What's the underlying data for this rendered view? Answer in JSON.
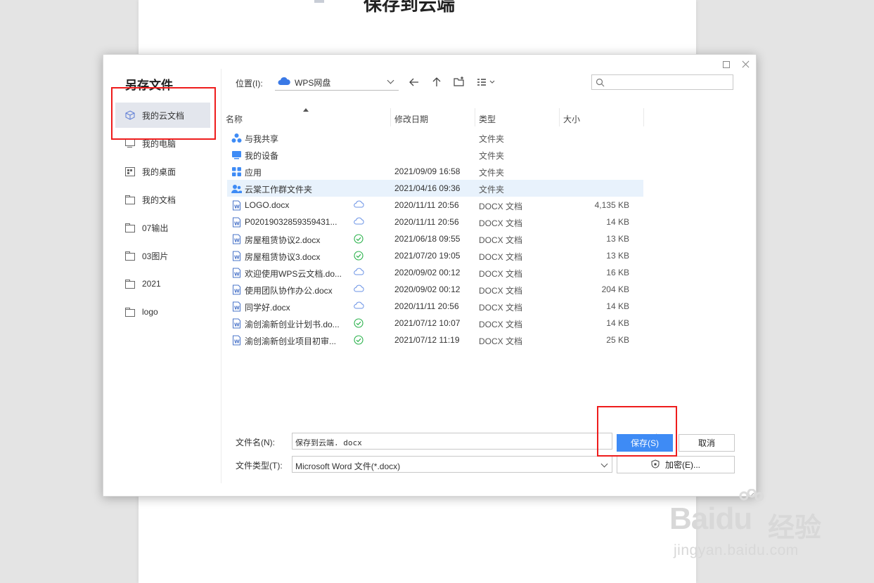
{
  "document": {
    "title_text": "保存到云端"
  },
  "dialog": {
    "title": "另存文件",
    "sidebar": [
      {
        "label": "我的云文档",
        "icon": "cloud-doc-icon",
        "active": true
      },
      {
        "label": "我的电脑",
        "icon": "computer-icon"
      },
      {
        "label": "我的桌面",
        "icon": "desktop-icon"
      },
      {
        "label": "我的文档",
        "icon": "folder-icon"
      },
      {
        "label": "07输出",
        "icon": "folder-icon"
      },
      {
        "label": "03图片",
        "icon": "folder-icon"
      },
      {
        "label": "2021",
        "icon": "folder-icon"
      },
      {
        "label": "logo",
        "icon": "folder-icon"
      }
    ],
    "toolbar": {
      "location_label": "位置(I):",
      "location_value": "WPS网盘",
      "search_placeholder": ""
    },
    "columns": {
      "name": "名称",
      "modified": "修改日期",
      "type": "类型",
      "size": "大小"
    },
    "files": [
      {
        "name": "与我共享",
        "icon": "share-folder-icon",
        "sync": "",
        "date": "",
        "type": "文件夹",
        "size": ""
      },
      {
        "name": "我的设备",
        "icon": "device-folder-icon",
        "sync": "",
        "date": "",
        "type": "文件夹",
        "size": ""
      },
      {
        "name": "应用",
        "icon": "apps-folder-icon",
        "sync": "",
        "date": "2021/09/09 16:58",
        "type": "文件夹",
        "size": ""
      },
      {
        "name": "云棠工作群文件夹",
        "icon": "group-folder-icon",
        "sync": "",
        "date": "2021/04/16 09:36",
        "type": "文件夹",
        "size": "",
        "selected": true
      },
      {
        "name": "LOGO.docx",
        "icon": "word-doc-icon",
        "sync": "cloud",
        "date": "2020/11/11 20:56",
        "type": "DOCX 文档",
        "size": "4,135 KB"
      },
      {
        "name": "P02019032859359431...",
        "icon": "word-doc-icon",
        "sync": "cloud",
        "date": "2020/11/11 20:56",
        "type": "DOCX 文档",
        "size": "14 KB"
      },
      {
        "name": "房屋租赁协议2.docx",
        "icon": "word-doc-icon",
        "sync": "check",
        "date": "2021/06/18 09:55",
        "type": "DOCX 文档",
        "size": "13 KB"
      },
      {
        "name": "房屋租赁协议3.docx",
        "icon": "word-doc-icon",
        "sync": "check",
        "date": "2021/07/20 19:05",
        "type": "DOCX 文档",
        "size": "13 KB"
      },
      {
        "name": "欢迎使用WPS云文档.do...",
        "icon": "word-doc-icon",
        "sync": "cloud",
        "date": "2020/09/02 00:12",
        "type": "DOCX 文档",
        "size": "16 KB"
      },
      {
        "name": "使用团队协作办公.docx",
        "icon": "word-doc-icon",
        "sync": "cloud",
        "date": "2020/09/02 00:12",
        "type": "DOCX 文档",
        "size": "204 KB"
      },
      {
        "name": "同学好.docx",
        "icon": "word-doc-icon",
        "sync": "cloud",
        "date": "2020/11/11 20:56",
        "type": "DOCX 文档",
        "size": "14 KB"
      },
      {
        "name": "渝创渝新创业计划书.do...",
        "icon": "word-doc-icon",
        "sync": "check",
        "date": "2021/07/12 10:07",
        "type": "DOCX 文档",
        "size": "14 KB"
      },
      {
        "name": "渝创渝新创业项目初审...",
        "icon": "word-doc-icon",
        "sync": "check",
        "date": "2021/07/12 11:19",
        "type": "DOCX 文档",
        "size": "25 KB"
      }
    ],
    "filename_label": "文件名(N):",
    "filename_value": "保存到云端. docx",
    "filetype_label": "文件类型(T):",
    "filetype_value": "Microsoft Word 文件(*.docx)",
    "save_label": "保存(S)",
    "cancel_label": "取消",
    "encrypt_label": "加密(E)..."
  },
  "watermark": {
    "logo": "Baidu",
    "cn": "经验",
    "url": "jingyan.baidu.com"
  },
  "colors": {
    "accent": "#3e8bf5",
    "highlight": "#ee1c1c",
    "selected_row": "#e8f2fc"
  }
}
